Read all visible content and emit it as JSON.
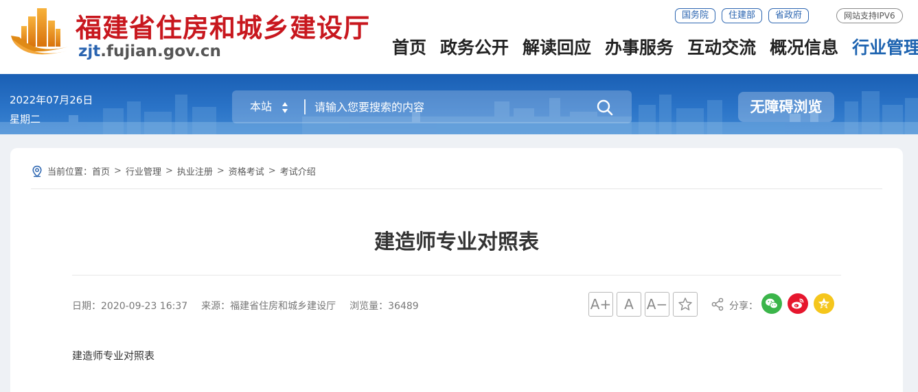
{
  "site": {
    "name": "福建省住房和城乡建设厅",
    "url_prefix": "zjt",
    "url_suffix": ".fujian.gov.cn"
  },
  "top_links": [
    "国务院",
    "住建部",
    "省政府"
  ],
  "ipv6_badge": "网站支持IPV6",
  "nav": {
    "items": [
      "首页",
      "政务公开",
      "解读回应",
      "办事服务",
      "互动交流",
      "概况信息",
      "行业管理"
    ],
    "active": "行业管理"
  },
  "banner": {
    "date": "2022年07月26日",
    "weekday": "星期二",
    "search_scope": "本站",
    "search_placeholder": "请输入您要搜索的内容",
    "accessible_label": "无障碍浏览"
  },
  "breadcrumb": {
    "prefix": "当前位置：",
    "items": [
      "首页",
      "行业管理",
      "执业注册",
      "资格考试",
      "考试介绍"
    ],
    "separator": ">"
  },
  "article": {
    "title": "建造师专业对照表",
    "date": "日期：2020-09-23 16:37",
    "source": "来源：福建省住房和城乡建设厅",
    "views": "浏览量：36489",
    "font_increase": "A+",
    "font_normal": "A",
    "font_decrease": "A−",
    "share_label": "分享：",
    "body": "建造师专业对照表"
  },
  "colors": {
    "brand_red": "#c8171e",
    "brand_blue": "#1d63b0",
    "wechat_green": "#3bb54a",
    "weibo_red": "#e6162d",
    "qzone_yellow": "#f5c61c"
  },
  "icons": [
    "logo-icon",
    "chevron-updown-icon",
    "search-icon",
    "location-pin-icon",
    "star-icon",
    "share-icon",
    "wechat-icon",
    "weibo-icon",
    "qzone-icon"
  ]
}
